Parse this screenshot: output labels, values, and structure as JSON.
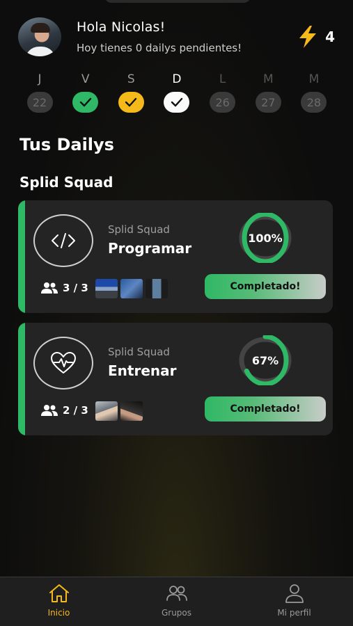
{
  "header": {
    "greeting": "Hola Nicolas!",
    "subtitle": "Hoy tienes 0 dailys pendientes!",
    "streak_count": "4",
    "streak_icon": "lightning-icon"
  },
  "week": [
    {
      "letter": "J",
      "day": "22",
      "state": "past"
    },
    {
      "letter": "V",
      "day": "",
      "state": "completed-green"
    },
    {
      "letter": "S",
      "day": "",
      "state": "completed-yellow"
    },
    {
      "letter": "D",
      "day": "",
      "state": "today-completed"
    },
    {
      "letter": "L",
      "day": "26",
      "state": "future"
    },
    {
      "letter": "M",
      "day": "27",
      "state": "future"
    },
    {
      "letter": "M",
      "day": "28",
      "state": "future"
    }
  ],
  "section_title": "Tus Dailys",
  "squad_title": "Splid Squad",
  "dailys": [
    {
      "squad": "Splid Squad",
      "name": "Programar",
      "progress": 100,
      "progress_label": "100%",
      "members": "3 / 3",
      "status": "Completado!",
      "icon": "code-icon"
    },
    {
      "squad": "Splid Squad",
      "name": "Entrenar",
      "progress": 67,
      "progress_label": "67%",
      "members": "2 / 3",
      "status": "Completado!",
      "icon": "heartbeat-icon"
    }
  ],
  "nav": {
    "home": "Inicio",
    "groups": "Grupos",
    "profile": "Mi perfil"
  },
  "colors": {
    "accent_green": "#2fb865",
    "accent_yellow": "#f6b91a",
    "card_bg": "#242424"
  }
}
